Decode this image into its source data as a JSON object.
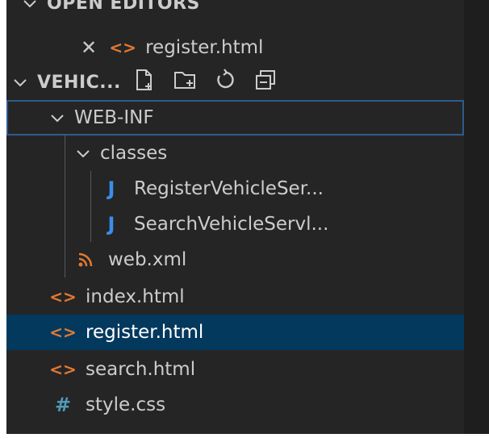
{
  "open_editors": {
    "header": "OPEN EDITORS",
    "items": [
      {
        "close_glyph": "✕",
        "icon": "html-icon",
        "label": "register.html"
      }
    ]
  },
  "workspace": {
    "header": "VEHIC...",
    "toolbar": [
      "new-file-icon",
      "new-folder-icon",
      "refresh-icon",
      "collapse-all-icon"
    ]
  },
  "tree": {
    "web_inf": "WEB-INF",
    "classes": "classes",
    "java_files": [
      "RegisterVehicleSer...",
      "SearchVehicleServl..."
    ],
    "web_xml": "web.xml",
    "root_files": [
      {
        "icon": "html-icon",
        "glyph": "<>",
        "label": "index.html"
      },
      {
        "icon": "html-icon",
        "glyph": "<>",
        "label": "register.html",
        "selected": true
      },
      {
        "icon": "html-icon",
        "glyph": "<>",
        "label": "search.html"
      },
      {
        "icon": "css-icon",
        "glyph": "#",
        "label": "style.css"
      }
    ]
  },
  "glyphs": {
    "java": "J"
  },
  "colors": {
    "html": "#e37933",
    "java": "#3b8eea",
    "css": "#519aba",
    "selection": "#04395e"
  }
}
